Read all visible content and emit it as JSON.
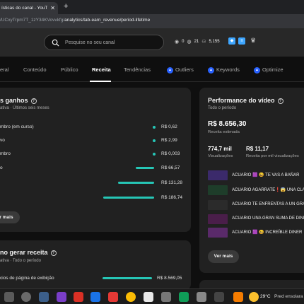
{
  "browser": {
    "tab_title": "ísticas do canal - YouTube",
    "tab_close": "✕",
    "new_tab": "+",
    "url_dim": "/UCxyTrpm7T_1zY34KVovvkfg/",
    "url_main": "analytics/tab-earn_revenue/period-lifetime"
  },
  "header": {
    "search_placeholder": "Pesquise no seu canal",
    "stat1": "0",
    "stat2": "21",
    "stat3": "5,155"
  },
  "tabs": [
    {
      "label": "eral"
    },
    {
      "label": "Conteúdo"
    },
    {
      "label": "Público"
    },
    {
      "label": "Receita"
    },
    {
      "label": "Tendências"
    },
    {
      "label": "Outliers"
    },
    {
      "label": "Keywords"
    },
    {
      "label": "Optimize"
    }
  ],
  "earnings": {
    "title": "s ganhos",
    "subtitle": "ativa · Últimos seis meses",
    "rows": [
      {
        "label": "mbro (em curso)",
        "value": "R$ 0,62",
        "fraction": 0.003
      },
      {
        "label": "vo",
        "value": "R$ 2,99",
        "fraction": 0.016
      },
      {
        "label": "mbro",
        "value": "R$ 0,003",
        "fraction": 0.0
      },
      {
        "label": "o",
        "value": "R$ 66,57",
        "fraction": 0.356
      },
      {
        "label": "",
        "value": "R$ 131,28",
        "fraction": 0.703
      },
      {
        "label": "",
        "value": "R$ 186,74",
        "fraction": 1.0
      }
    ],
    "button": "r mais"
  },
  "howto": {
    "title": "no gerar receita",
    "subtitle": "ativa · Todo o período",
    "row_label": "cios de página de exibição",
    "row_value": "R$ 8.569,05"
  },
  "performance": {
    "title": "Performance do vídeo",
    "subtitle": "Todo o período",
    "revenue": "R$ 8.656,30",
    "revenue_label": "Receita estimada",
    "views": "774,7 mil",
    "views_label": "Visualizações",
    "rpm": "R$ 11,17",
    "rpm_label": "Receita por mil visualizações",
    "videos": [
      {
        "title": "ACUARIO 🟪 😀 TE VAS A BAÑAR",
        "thumb_color": "#3b2a6b"
      },
      {
        "title": "ACUARIO AGARRATE❗😱 UNA CLA",
        "thumb_color": "#1e3d2a"
      },
      {
        "title": "ACUARIO TE ENFRENTAS A UN GRA",
        "thumb_color": "#2b2b2b"
      },
      {
        "title": "ACUARIO UNA GRAN SUMA DE DINE",
        "thumb_color": "#4a1e4a"
      },
      {
        "title": "ACUARIO 🟪 😀 INCREÍBLE DINER",
        "thumb_color": "#5a2a6a"
      }
    ],
    "button": "Ver mais"
  },
  "taskbar": {
    "temp": "29°C",
    "weather": "Pred ensolara"
  }
}
